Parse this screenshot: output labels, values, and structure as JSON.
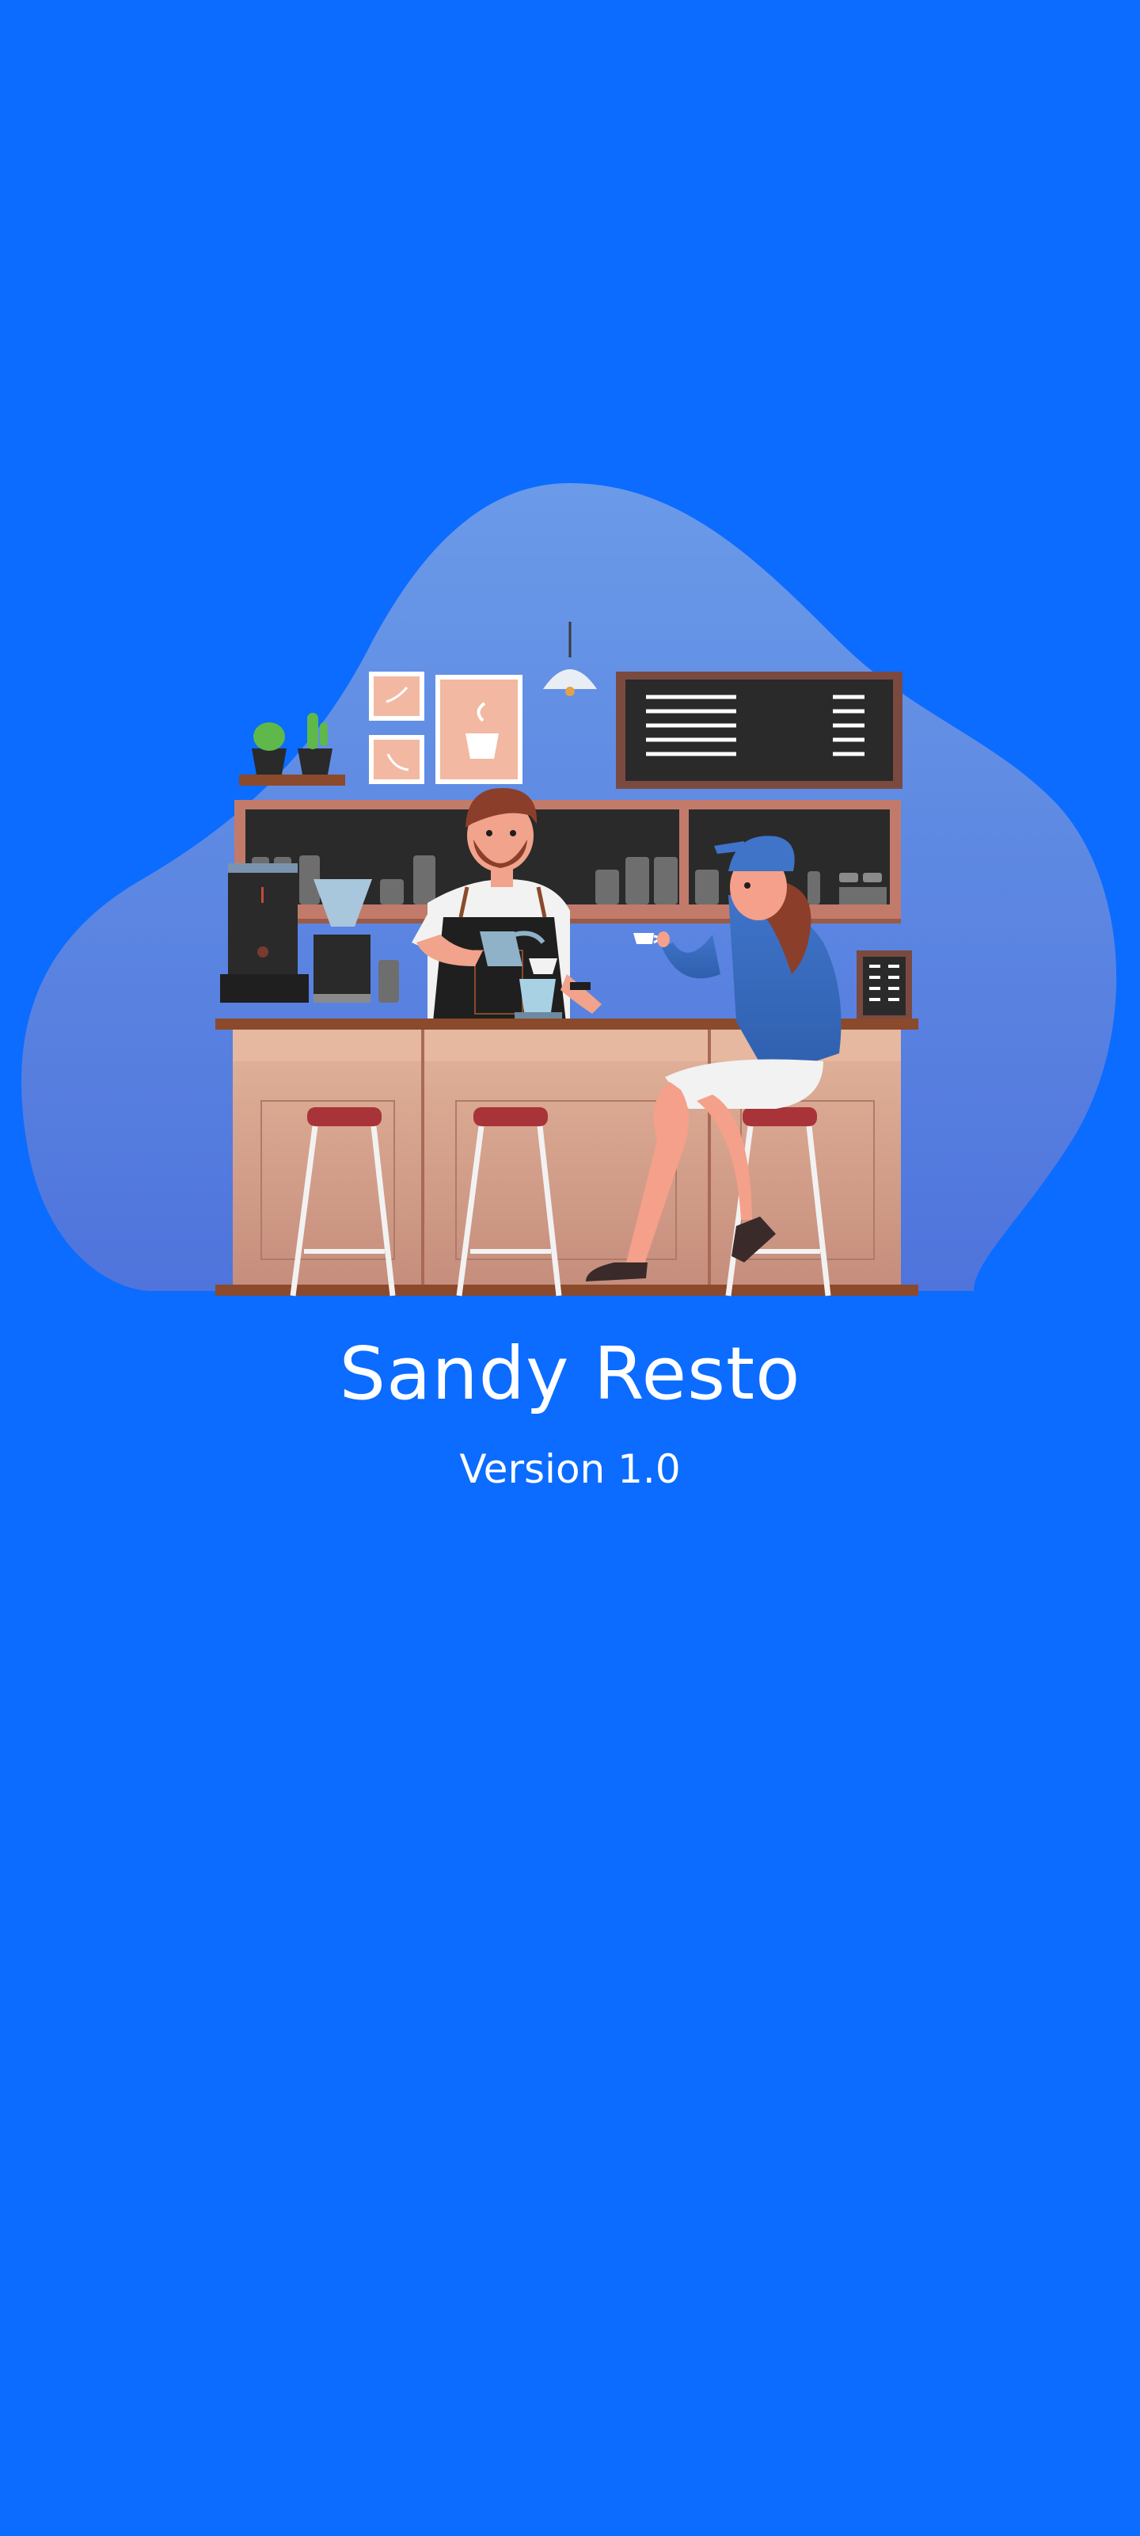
{
  "splash": {
    "app_title": "Sandy Resto",
    "version_label": "Version 1.0"
  },
  "illustration": {
    "subject": "cafe-counter-barista-and-customer-illustration"
  },
  "colors": {
    "background": "#0b6cff",
    "blob": "#5b8fe6",
    "text": "#ffffff",
    "counter": "#d4a08a",
    "counter_top": "#8b4a2b",
    "stool_seat": "#a8343a",
    "chalkboard": "#2a2a2a",
    "frame": "#f2b8a2"
  }
}
